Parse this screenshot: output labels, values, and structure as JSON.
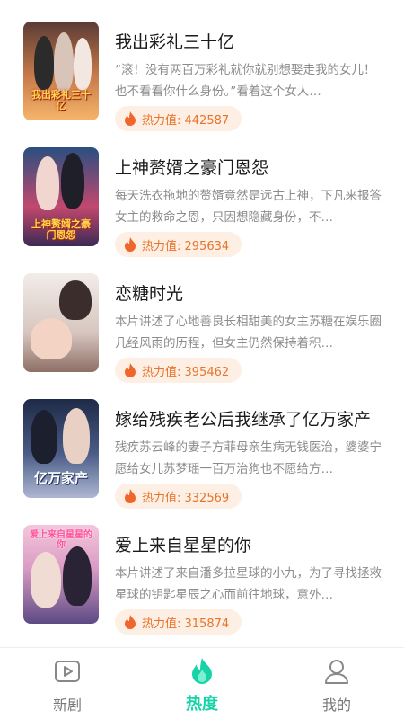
{
  "colors": {
    "accent": "#18d3a7",
    "heat_text": "#e8732a",
    "heat_bg": "#fdefe4",
    "title": "#1a1a1a",
    "desc": "#8c8c8c"
  },
  "dramas": [
    {
      "title": "我出彩礼三十亿",
      "desc": "“滚！没有两百万彩礼就你就别想娶走我的女儿！也不看看你什么身份。”看着这个女人…",
      "heat_label": "热力值: 442587",
      "cover_text": "我出彩礼三十亿",
      "cover_colors": [
        "#f2a15d",
        "#7a3b2a"
      ]
    },
    {
      "title": "上神赘婿之豪门恩怨",
      "desc": "每天洗衣拖地的赘婿竟然是远古上神，下凡来报答女主的救命之恩，只因想隐藏身份，不…",
      "heat_label": "热力值: 295634",
      "cover_text": "上神赘婿之豪门恩怨",
      "cover_colors": [
        "#3a6fa8",
        "#d84b6a"
      ]
    },
    {
      "title": "恋糖时光",
      "desc": "本片讲述了心地善良长相甜美的女主苏糖在娱乐圈几经风雨的历程，但女主仍然保持着积…",
      "heat_label": "热力值: 395462",
      "cover_text": "",
      "cover_colors": [
        "#e9e2df",
        "#b9a39b"
      ]
    },
    {
      "title": "嫁给残疾老公后我继承了亿万家产",
      "desc": "残疾苏云峰的妻子方菲母亲生病无钱医治，婆婆宁愿给女儿苏梦瑶一百万治狗也不愿给方…",
      "heat_label": "热力值: 332569",
      "cover_text": "亿万家产",
      "cover_colors": [
        "#2d3e63",
        "#7f8db3"
      ]
    },
    {
      "title": "爱上来自星星的你",
      "desc": "本片讲述了来自潘多拉星球的小九，为了寻找拯救星球的钥匙星辰之心而前往地球，意外…",
      "heat_label": "热力值: 315874",
      "cover_text": "爱上来自星星的你",
      "cover_colors": [
        "#e9a7c9",
        "#6b4f8f"
      ]
    }
  ],
  "tabbar": {
    "tabs": [
      {
        "label": "新剧",
        "icon": "play-icon"
      },
      {
        "label": "热度",
        "icon": "flame-icon"
      },
      {
        "label": "我的",
        "icon": "user-icon"
      }
    ],
    "active_index": 1
  }
}
